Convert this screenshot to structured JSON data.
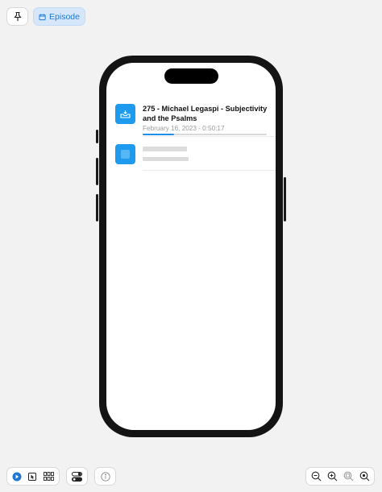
{
  "toolbar_top": {
    "pin_icon": "pin-icon",
    "episode_icon": "calendar-icon",
    "episode_label": "Episode"
  },
  "episode": {
    "title": "275 - Michael Legaspi - Subjectivity and the Psalms",
    "meta": "February 16, 2023 - 0:50:17",
    "progress": 0.25,
    "art_icon": "inbox-tray-icon",
    "art_color": "#1e9bef"
  },
  "placeholder_row": {
    "art_color": "#1e9bef"
  },
  "toolbar_bottom": {
    "icons": [
      "play-icon",
      "cursor-select-icon",
      "grid-icon",
      "toggle-icon",
      "info-icon",
      "zoom-out-icon",
      "zoom-in-icon",
      "zoom-fit-icon",
      "zoom-reset-icon"
    ],
    "accent": "#1f78d1"
  }
}
